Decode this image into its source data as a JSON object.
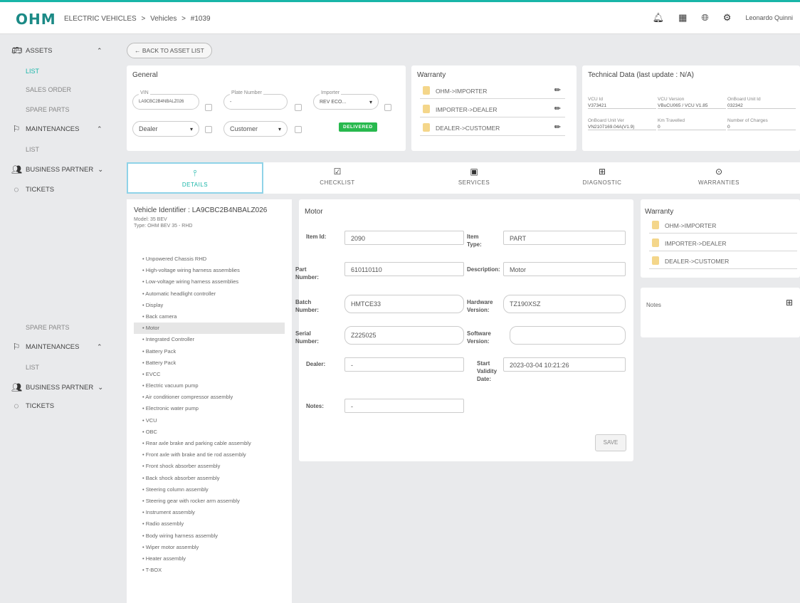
{
  "topbar": {
    "logo": "OHM",
    "breadcrumb": [
      "ELECTRIC VEHICLES",
      ">",
      "Vehicles",
      ">",
      "#1039"
    ],
    "user": "Leonardo Quinni",
    "icons": [
      "bell-icon",
      "grid-icon",
      "globe-icon",
      "gear-icon"
    ]
  },
  "sidebar": {
    "assets": "ASSETS",
    "list": "LIST",
    "sales_order": "SALES ORDER",
    "spare_parts": "SPARE PARTS",
    "maintenances": "MAINTENANCES",
    "maint_list": "LIST",
    "business_partner": "BUSINESS PARTNER",
    "tickets": "TICKETS",
    "spare_parts_2": "SPARE PARTS",
    "maintenances_2": "MAINTENANCES",
    "maint_list_2": "LIST",
    "business_partner_2": "BUSINESS PARTNER",
    "tickets_2": "TICKETS"
  },
  "back_button": "← BACK TO ASSET LIST",
  "general": {
    "title": "General",
    "vin_label": "VIN",
    "vin_value": "LA9CBC2B4NBALZ026",
    "plate_label": "Plate Number",
    "plate_value": "-",
    "importer_label": "Importer",
    "importer_value": "REV ECO...",
    "dealer_value": "Dealer",
    "customer_value": "Customer",
    "status_badge": "DELIVERED"
  },
  "warranty_top": {
    "title": "Warranty",
    "items": [
      "OHM->IMPORTER",
      "IMPORTER->DEALER",
      "DEALER->CUSTOMER"
    ]
  },
  "technical": {
    "title": "Technical Data (last update : N/A)",
    "cells": [
      {
        "label": "VCU Id",
        "value": "V373421"
      },
      {
        "label": "VCU Version",
        "value": "VBuCU065 / VCU V1.85"
      },
      {
        "label": "OnBoard Unit Id",
        "value": "032342"
      },
      {
        "label": "OnBoard Unit Ver",
        "value": "VN2107169.04A(V1.9)"
      },
      {
        "label": "Km Travelled",
        "value": "0"
      },
      {
        "label": "Number of Charges",
        "value": "0"
      }
    ]
  },
  "tabs": [
    {
      "label": "DETAILS",
      "icon": "branch-icon"
    },
    {
      "label": "CHECKLIST",
      "icon": "checklist-icon"
    },
    {
      "label": "SERVICES",
      "icon": "ticket-icon"
    },
    {
      "label": "DIAGNOSTIC",
      "icon": "diagnostic-icon"
    },
    {
      "label": "WARRANTIES",
      "icon": "award-icon"
    }
  ],
  "vehicle": {
    "identifier": "Vehicle Identifier : LA9CBC2B4NBALZ026",
    "model": "Model: 35 BEV",
    "type": "Type: OHM BEV 35 - RHD",
    "components": [
      "Unpowered Chassis RHD",
      "High-voltage wiring harness assemblies",
      "Low-voltage wiring harness assemblies",
      "Automatic headlight controller",
      "Display",
      "Back camera",
      "Motor",
      "Integrated Controller",
      "Battery Pack",
      "Battery Pack",
      "EVCC",
      "Electric vacuum pump",
      "Air conditioner compressor assembly",
      "Electronic water pump",
      "VCU",
      "OBC",
      "Rear axle brake and parking cable assembly",
      "Front axle with brake and tie rod assembly",
      "Front shock absorber assembly",
      "Back shock absorber assembly",
      "Steering column assembly",
      "Steering gear with rocker arm assembly",
      "Instrument assembly",
      "Radio assembly",
      "Body wiring harness assembly",
      "Wiper motor assembly",
      "Heater assembly",
      "T-BOX"
    ]
  },
  "motor": {
    "title": "Motor",
    "item_id_label": "Item Id:",
    "item_id": "2090",
    "item_type_label": "Item Type:",
    "item_type": "PART",
    "part_number_label": "Part Number:",
    "part_number": "610110110",
    "description_label": "Description:",
    "description": "Motor",
    "batch_label": "Batch Number:",
    "batch": "HMTCE33",
    "hardware_label": "Hardware Version:",
    "hardware": "TZ190XSZ",
    "serial_label": "Serial Number:",
    "serial": "Z225025",
    "software_label": "Software Version:",
    "software": "",
    "dealer_label": "Dealer:",
    "dealer": "-",
    "start_label": "Start Validity Date:",
    "start": "2023-03-04 10:21:26",
    "notes_label": "Notes:",
    "notes": "-",
    "save": "SAVE"
  },
  "warranty_side": {
    "title": "Warranty",
    "items": [
      "OHM->IMPORTER",
      "IMPORTER->DEALER",
      "DEALER->CUSTOMER"
    ]
  },
  "notes_card": {
    "title": "Notes"
  },
  "colors": {
    "accent": "#19b5a8",
    "badge_green": "#28b94e",
    "warranty_dot": "#f4d68a"
  }
}
